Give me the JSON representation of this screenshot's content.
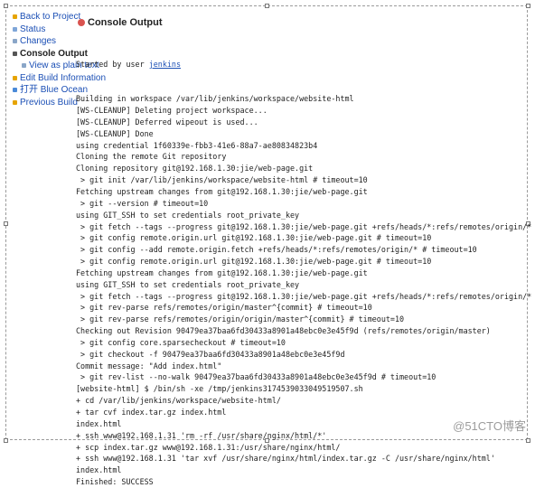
{
  "sidebar": {
    "items": [
      {
        "label": "Back to Project",
        "color": "#e6a400",
        "sub": false,
        "active": false
      },
      {
        "label": "Status",
        "color": "#7fa6d8",
        "sub": false,
        "active": false
      },
      {
        "label": "Changes",
        "color": "#8aa6c8",
        "sub": false,
        "active": false
      },
      {
        "label": "Console Output",
        "color": "#555555",
        "sub": false,
        "active": true
      },
      {
        "label": "View as plain text",
        "color": "#8aa6c8",
        "sub": true,
        "active": false
      },
      {
        "label": "Edit Build Information",
        "color": "#e6a400",
        "sub": false,
        "active": false
      },
      {
        "label": "打开 Blue Ocean",
        "color": "#4a8ad8",
        "sub": false,
        "active": false
      },
      {
        "label": "Previous Build",
        "color": "#e6a400",
        "sub": false,
        "active": false
      }
    ]
  },
  "console": {
    "title": "Console Output",
    "started_prefix": "Started by user ",
    "user": "jenkins",
    "lines": [
      "Building in workspace /var/lib/jenkins/workspace/website-html",
      "[WS-CLEANUP] Deleting project workspace...",
      "[WS-CLEANUP] Deferred wipeout is used...",
      "[WS-CLEANUP] Done",
      "using credential 1f60339e-fbb3-41e6-88a7-ae80834823b4",
      "Cloning the remote Git repository",
      "Cloning repository git@192.168.1.30:jie/web-page.git",
      " > git init /var/lib/jenkins/workspace/website-html # timeout=10",
      "Fetching upstream changes from git@192.168.1.30:jie/web-page.git",
      " > git --version # timeout=10",
      "using GIT_SSH to set credentials root_private_key",
      " > git fetch --tags --progress git@192.168.1.30:jie/web-page.git +refs/heads/*:refs/remotes/origin/*",
      " > git config remote.origin.url git@192.168.1.30:jie/web-page.git # timeout=10",
      " > git config --add remote.origin.fetch +refs/heads/*:refs/remotes/origin/* # timeout=10",
      " > git config remote.origin.url git@192.168.1.30:jie/web-page.git # timeout=10",
      "Fetching upstream changes from git@192.168.1.30:jie/web-page.git",
      "using GIT_SSH to set credentials root_private_key",
      " > git fetch --tags --progress git@192.168.1.30:jie/web-page.git +refs/heads/*:refs/remotes/origin/*",
      " > git rev-parse refs/remotes/origin/master^{commit} # timeout=10",
      " > git rev-parse refs/remotes/origin/origin/master^{commit} # timeout=10",
      "Checking out Revision 90479ea37baa6fd30433a8901a48ebc0e3e45f9d (refs/remotes/origin/master)",
      " > git config core.sparsecheckout # timeout=10",
      " > git checkout -f 90479ea37baa6fd30433a8901a48ebc0e3e45f9d",
      "Commit message: \"Add index.html\"",
      " > git rev-list --no-walk 90479ea37baa6fd30433a8901a48ebc0e3e45f9d # timeout=10",
      "[website-html] $ /bin/sh -xe /tmp/jenkins3174539033049519507.sh",
      "+ cd /var/lib/jenkins/workspace/website-html/",
      "+ tar cvf index.tar.gz index.html",
      "index.html",
      "+ ssh www@192.168.1.31 'rm -rf /usr/share/nginx/html/*'",
      "+ scp index.tar.gz www@192.168.1.31:/usr/share/nginx/html/",
      "+ ssh www@192.168.1.31 'tar xvf /usr/share/nginx/html/index.tar.gz -C /usr/share/nginx/html'",
      "index.html",
      "Finished: SUCCESS"
    ]
  },
  "watermark": "@51CTO博客"
}
